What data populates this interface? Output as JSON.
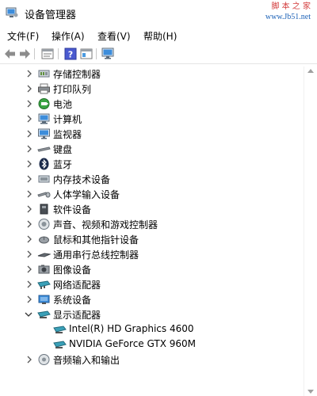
{
  "window": {
    "title": "设备管理器",
    "watermark": {
      "brand": "脚 本 之 家",
      "url": "www.Jb51.net"
    }
  },
  "menubar": {
    "items": [
      {
        "label": "文件(F)"
      },
      {
        "label": "操作(A)"
      },
      {
        "label": "查看(V)"
      },
      {
        "label": "帮助(H)"
      }
    ]
  },
  "toolbar": {
    "buttons": [
      "back-icon",
      "forward-icon",
      "properties-icon",
      "help-icon",
      "view-icon",
      "monitor-icon"
    ]
  },
  "tree": {
    "items": [
      {
        "label": "存储控制器",
        "icon": "storage-controller-icon",
        "expanded": false
      },
      {
        "label": "打印队列",
        "icon": "printer-icon",
        "expanded": false
      },
      {
        "label": "电池",
        "icon": "battery-icon",
        "expanded": false
      },
      {
        "label": "计算机",
        "icon": "computer-icon",
        "expanded": false
      },
      {
        "label": "监视器",
        "icon": "monitor-icon",
        "expanded": false
      },
      {
        "label": "键盘",
        "icon": "keyboard-icon",
        "expanded": false
      },
      {
        "label": "蓝牙",
        "icon": "bluetooth-icon",
        "expanded": false
      },
      {
        "label": "内存技术设备",
        "icon": "memory-device-icon",
        "expanded": false
      },
      {
        "label": "人体学输入设备",
        "icon": "hid-icon",
        "expanded": false
      },
      {
        "label": "软件设备",
        "icon": "software-device-icon",
        "expanded": false
      },
      {
        "label": "声音、视频和游戏控制器",
        "icon": "sound-icon",
        "expanded": false
      },
      {
        "label": "鼠标和其他指针设备",
        "icon": "mouse-icon",
        "expanded": false
      },
      {
        "label": "通用串行总线控制器",
        "icon": "usb-icon",
        "expanded": false
      },
      {
        "label": "图像设备",
        "icon": "camera-icon",
        "expanded": false
      },
      {
        "label": "网络适配器",
        "icon": "network-adapter-icon",
        "expanded": false
      },
      {
        "label": "系统设备",
        "icon": "system-device-icon",
        "expanded": false
      },
      {
        "label": "显示适配器",
        "icon": "display-adapter-icon",
        "expanded": true
      },
      {
        "label": "Intel(R) HD Graphics 4600",
        "icon": "display-adapter-icon",
        "child": true
      },
      {
        "label": "NVIDIA GeForce GTX 960M",
        "icon": "display-adapter-icon",
        "child": true
      },
      {
        "label": "音频输入和输出",
        "icon": "audio-io-icon",
        "expanded": false
      }
    ]
  }
}
